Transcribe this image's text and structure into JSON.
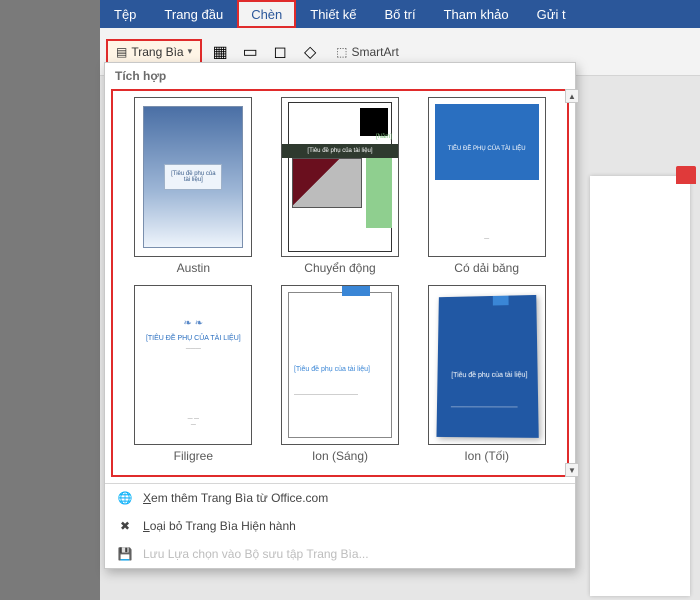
{
  "tabs": {
    "file": "Tệp",
    "home": "Trang đầu",
    "insert": "Chèn",
    "design": "Thiết kế",
    "layout": "Bố trí",
    "references": "Tham khảo",
    "mailings": "Gửi t"
  },
  "ribbon": {
    "cover_page": "Trang Bìa",
    "smartart": "SmartArt"
  },
  "gallery": {
    "section_header": "Tích hợp",
    "items": [
      {
        "name": "Austin",
        "subtitle": "[Tiêu đề phụ của tài liệu]"
      },
      {
        "name": "Chuyển động",
        "subtitle": "[Tiêu đề phụ của tài liệu]",
        "year": "[Năm]"
      },
      {
        "name": "Có dải băng",
        "subtitle": "TIÊU ĐỀ PHỤ CỦA TÀI LIỆU"
      },
      {
        "name": "Filigree",
        "subtitle": "[TIÊU ĐỀ PHỤ CỦA TÀI LIỆU]"
      },
      {
        "name": "Ion (Sáng)",
        "subtitle": "[Tiêu đề phụ của tài liệu]"
      },
      {
        "name": "Ion (Tối)",
        "subtitle": "[Tiêu đề phụ của tài liệu]"
      }
    ],
    "menu": {
      "more_office": "Xem thêm Trang Bìa từ Office.com",
      "remove_current": "Loại bỏ Trang Bìa Hiện hành",
      "save_selection": "Lưu Lựa chọn vào Bộ sưu tập Trang Bìa..."
    }
  },
  "colors": {
    "word_blue": "#2b579a",
    "highlight_red": "#e02b2b"
  }
}
